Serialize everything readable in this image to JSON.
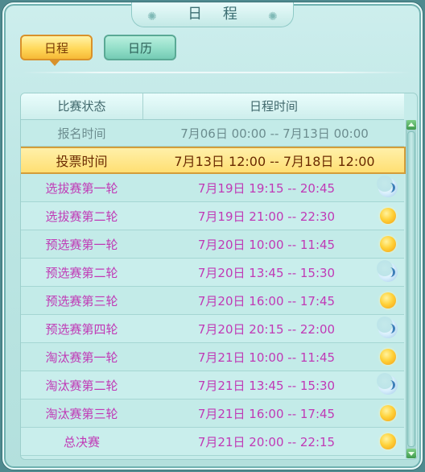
{
  "window": {
    "title": "日 程"
  },
  "tabs": [
    {
      "label": "日程",
      "active": true
    },
    {
      "label": "日历",
      "active": false
    }
  ],
  "table": {
    "headers": {
      "status": "比赛状态",
      "time": "日程时间"
    },
    "rows": [
      {
        "name": "报名时间",
        "time": "7月06日 00:00 -- 7月13日 00:00",
        "state": "past",
        "icon": ""
      },
      {
        "name": "投票时间",
        "time": "7月13日 12:00 -- 7月18日 12:00",
        "state": "current",
        "icon": ""
      },
      {
        "name": "选拔赛第一轮",
        "time": "7月19日 19:15 -- 20:45",
        "state": "future",
        "icon": "moon-icon"
      },
      {
        "name": "选拔赛第二轮",
        "time": "7月19日 21:00 -- 22:30",
        "state": "future",
        "icon": "sun-icon"
      },
      {
        "name": "预选赛第一轮",
        "time": "7月20日 10:00 -- 11:45",
        "state": "future",
        "icon": "sun-icon"
      },
      {
        "name": "预选赛第二轮",
        "time": "7月20日 13:45 -- 15:30",
        "state": "future",
        "icon": "moon-icon"
      },
      {
        "name": "预选赛第三轮",
        "time": "7月20日 16:00 -- 17:45",
        "state": "future",
        "icon": "sun-icon"
      },
      {
        "name": "预选赛第四轮",
        "time": "7月20日 20:15 -- 22:00",
        "state": "future",
        "icon": "moon-icon"
      },
      {
        "name": "淘汰赛第一轮",
        "time": "7月21日 10:00 -- 11:45",
        "state": "future",
        "icon": "sun-icon"
      },
      {
        "name": "淘汰赛第二轮",
        "time": "7月21日 13:45 -- 15:30",
        "state": "future",
        "icon": "moon-icon"
      },
      {
        "name": "淘汰赛第三轮",
        "time": "7月21日 16:00 -- 17:45",
        "state": "future",
        "icon": "sun-icon"
      },
      {
        "name": "总决赛",
        "time": "7月21日 20:00 -- 22:15",
        "state": "future",
        "icon": "sun-icon"
      }
    ]
  },
  "colors": {
    "past_text": "#6c8d8f",
    "current_text": "#6a2a00",
    "future_text": "#c03ab6",
    "highlight": "#ffdf73"
  }
}
